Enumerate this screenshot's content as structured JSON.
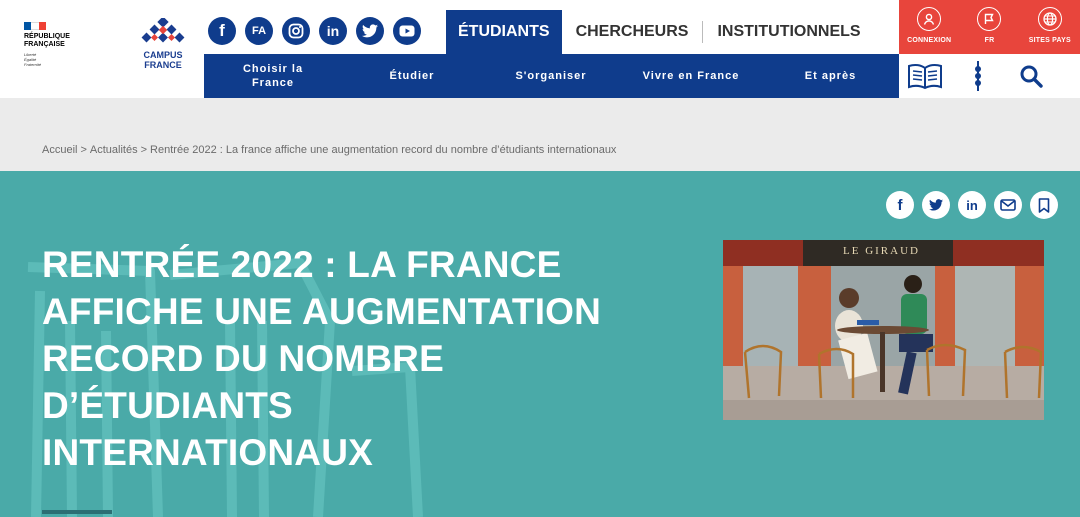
{
  "republique": {
    "name": "RÉPUBLIQUE\nFRANÇAISE",
    "motto": "Liberté\nÉgalité\nFraternité",
    "flag_colors": [
      "#0055a4",
      "#ffffff",
      "#ef4135"
    ]
  },
  "brand": {
    "name": "CAMPUS\nFRANCE",
    "color": "#1a3d8f"
  },
  "social": [
    {
      "name": "facebook-icon",
      "glyph": "f"
    },
    {
      "name": "fa-icon",
      "glyph": "FA"
    },
    {
      "name": "instagram-icon",
      "glyph": ""
    },
    {
      "name": "linkedin-icon",
      "glyph": "in"
    },
    {
      "name": "twitter-icon",
      "glyph": ""
    },
    {
      "name": "youtube-icon",
      "glyph": ""
    }
  ],
  "audience_tabs": [
    {
      "label": "ÉTUDIANTS",
      "active": true
    },
    {
      "label": "CHERCHEURS",
      "active": false
    },
    {
      "label": "INSTITUTIONNELS",
      "active": false
    }
  ],
  "utility": [
    {
      "label": "CONNEXION",
      "icon": "user-icon"
    },
    {
      "label": "FR",
      "icon": "flag-icon"
    },
    {
      "label": "SITES PAYS",
      "icon": "globe-icon"
    }
  ],
  "main_nav": [
    "Choisir la France",
    "Étudier",
    "S'organiser",
    "Vivre en France",
    "Et après"
  ],
  "tools": [
    "catalogue-book-icon",
    "menu-dots-icon",
    "search-icon"
  ],
  "breadcrumb": [
    "Accueil",
    "Actualités",
    "Rentrée 2022 : La france affiche une augmentation record du nombre d’étudiants internationaux"
  ],
  "breadcrumb_separator": ">",
  "article": {
    "title": "RENTRÉE 2022 : LA FRANCE AFFICHE UNE AUGMENTATION RECORD DU NOMBRE D’ÉTUDIANTS INTERNATIONAUX",
    "photo_sign": "LE GIRAUD"
  },
  "share": [
    "facebook-icon",
    "twitter-icon",
    "linkedin-icon",
    "email-icon",
    "bookmark-icon"
  ],
  "colors": {
    "navy": "#0f3c8c",
    "red": "#e8453c",
    "teal": "#4aaaa8",
    "breadcrumb_bg": "#ebebeb"
  }
}
